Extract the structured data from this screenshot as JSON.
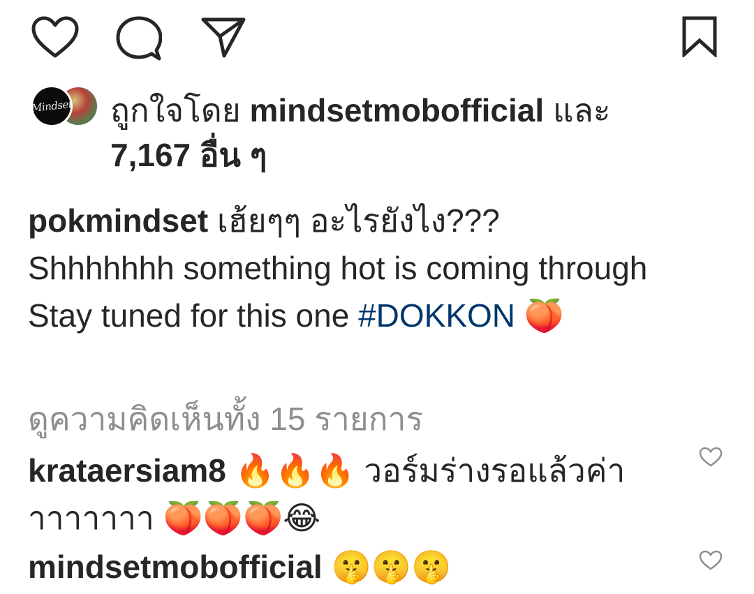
{
  "actions": {
    "like_icon": "heart-outline-icon",
    "comment_icon": "comment-bubble-icon",
    "share_icon": "paper-plane-icon",
    "save_icon": "bookmark-outline-icon"
  },
  "likes": {
    "prefix": "ถูกใจโดย",
    "user": "mindsetmobofficial",
    "joiner": "และ",
    "count_text": "7,167 อื่น ๆ",
    "avatar_brand": "Mindset"
  },
  "caption": {
    "user": "pokmindset",
    "line1": "เฮ้ยๆๆ อะไรยังไง???",
    "line2": "Shhhhhhh something hot is coming through",
    "line3_text": "Stay tuned for this one ",
    "hashtag": "#DOKKON",
    "emoji": "🍑"
  },
  "view_all_comments": "ดูความคิดเห็นทั้ง 15 รายการ",
  "comments": [
    {
      "user": "krataersiam8",
      "text": "🔥🔥🔥 วอร์มร่างรอแล้วค่าาาาาาาา 🍑🍑🍑😂"
    },
    {
      "user": "mindsetmobofficial",
      "text": "🤫🤫🤫"
    }
  ],
  "colors": {
    "text": "#262626",
    "muted": "#8e8e8e",
    "hashtag": "#00376b"
  }
}
